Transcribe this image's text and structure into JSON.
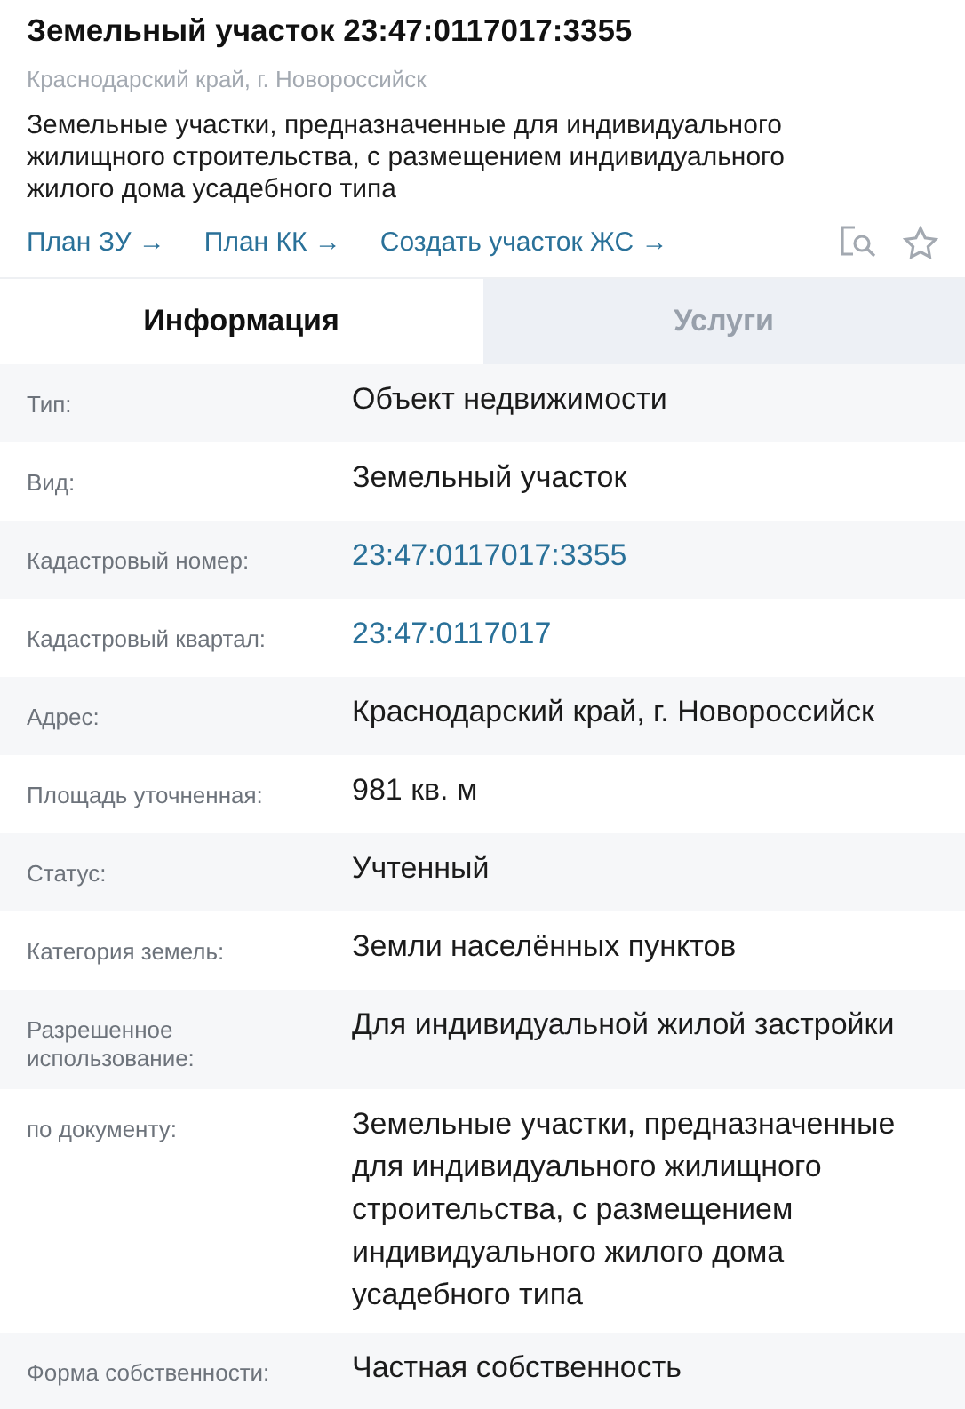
{
  "title": "Земельный участок 23:47:0117017:3355",
  "address": "Краснодарский край, г. Новороссийск",
  "description": "Земельные участки, предназначенные для индивидуального жилищного строительства, с размещением индивидуального жилого дома усадебного типа",
  "links": [
    "План ЗУ →",
    "План КК →",
    "Создать участок ЖС →"
  ],
  "tabs": [
    {
      "label": "Информация",
      "selected": true
    },
    {
      "label": "Услуги",
      "selected": false
    }
  ],
  "rows": [
    {
      "label": "Тип:",
      "value": "Объект недвижимости",
      "kind": "text"
    },
    {
      "label": "Вид:",
      "value": "Земельный участок",
      "kind": "text"
    },
    {
      "label": "Кадастровый номер:",
      "value": "23:47:0117017:3355",
      "kind": "link"
    },
    {
      "label": "Кадастровый квартал:",
      "value": "23:47:0117017",
      "kind": "link"
    },
    {
      "label": "Адрес:",
      "value": "Краснодарский край, г. Новороссийск",
      "kind": "text"
    },
    {
      "label": "Площадь уточненная:",
      "value": "981 кв. м",
      "kind": "text"
    },
    {
      "label": "Статус:",
      "value": "Учтенный",
      "kind": "text"
    },
    {
      "label": "Категория земель:",
      "value": "Земли населённых пунктов",
      "kind": "text"
    },
    {
      "label": "Разрешенное использование:",
      "value": "Для индивидуальной жилой застройки",
      "kind": "text"
    },
    {
      "label": "по документу:",
      "value": "Земельные участки, предназначенные для индивидуального жилищного строительства, с размещением индивидуального жилого дома усадебного типа",
      "kind": "text"
    },
    {
      "label": "Форма собственности:",
      "value": "Частная собственность",
      "kind": "text"
    }
  ]
}
